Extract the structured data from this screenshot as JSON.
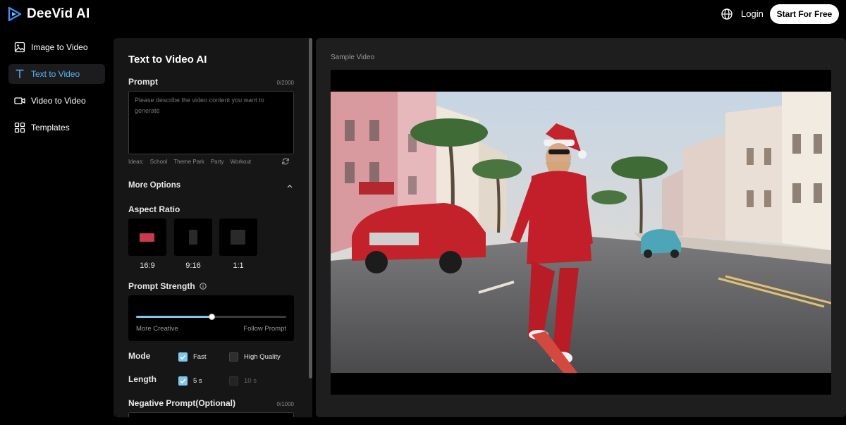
{
  "header": {
    "brand": "DeeVid AI",
    "login": "Login",
    "start_button": "Start For Free",
    "icons": [
      "deevid-logo",
      "globe-icon"
    ]
  },
  "sidebar": {
    "items": [
      {
        "label": "Image to Video",
        "icon": "image-icon",
        "active": false
      },
      {
        "label": "Text to Video",
        "icon": "text-icon",
        "active": true
      },
      {
        "label": "Video to Video",
        "icon": "video-camera-icon",
        "active": false
      },
      {
        "label": "Templates",
        "icon": "grid-icon",
        "active": false
      }
    ]
  },
  "form": {
    "title": "Text to Video AI",
    "prompt_label": "Prompt",
    "prompt_counter": "0/2000",
    "prompt_placeholder": "Please describe the video content you want to generate",
    "ideas_label": "Ideas:",
    "ideas": [
      "School",
      "Theme Park",
      "Party",
      "Workout"
    ],
    "more_options": "More Options",
    "aspect_label": "Aspect Ratio",
    "aspect_options": [
      "16:9",
      "9:16",
      "1:1"
    ],
    "aspect_selected": "16:9",
    "strength_label": "Prompt Strength",
    "strength_left": "More Creative",
    "strength_right": "Follow Prompt",
    "strength_value": 0.5,
    "mode_label": "Mode",
    "mode_options": [
      "Fast",
      "High Quality"
    ],
    "mode_selected": "Fast",
    "length_label": "Length",
    "length_options": [
      "5 s",
      "10 s"
    ],
    "length_selected": "5 s",
    "negative_label": "Negative Prompt(Optional)",
    "negative_counter": "0/1000"
  },
  "preview": {
    "label": "Sample Video"
  },
  "colors": {
    "accent": "#7ec8ef",
    "active_text": "#56b6f2",
    "aspect_highlight": "#c9394f"
  }
}
